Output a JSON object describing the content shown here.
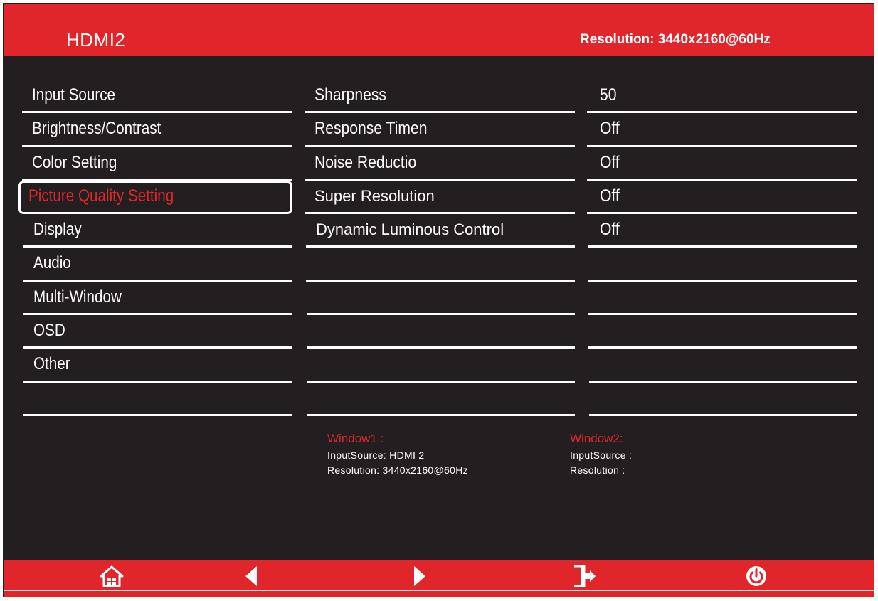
{
  "header": {
    "input_name": "HDMI2",
    "resolution": "Resolution: 3440x2160@60Hz"
  },
  "menu": [
    {
      "label": "Input Source",
      "selected": false
    },
    {
      "label": "Brightness/Contrast",
      "selected": false
    },
    {
      "label": "Color Setting",
      "selected": false
    },
    {
      "label": "Picture Quality Setting",
      "selected": true
    },
    {
      "label": "Display",
      "selected": false
    },
    {
      "label": "Audio",
      "selected": false
    },
    {
      "label": "Multi-Window",
      "selected": false
    },
    {
      "label": "OSD",
      "selected": false
    },
    {
      "label": "Other",
      "selected": false
    }
  ],
  "settings": [
    {
      "label": "Sharpness",
      "value": "50"
    },
    {
      "label": "Response Timen",
      "value": "Off"
    },
    {
      "label": "Noise Reductio",
      "value": "Off"
    },
    {
      "label": "Super Resolution",
      "value": "Off"
    },
    {
      "label": "Dynamic Luminous Control",
      "value": "Off"
    }
  ],
  "windows": {
    "window1": {
      "title": "Window1 :",
      "input_source": "InputSource: HDMI 2",
      "resolution": "Resolution: 3440x2160@60Hz"
    },
    "window2": {
      "title": "Window2:",
      "input_source": "InputSource :",
      "resolution": "Resolution :"
    }
  },
  "footer": {
    "buttons": [
      {
        "name": "home",
        "icon": "home-icon"
      },
      {
        "name": "left",
        "icon": "arrow-left-icon"
      },
      {
        "name": "right",
        "icon": "arrow-right-icon"
      },
      {
        "name": "exit",
        "icon": "exit-icon"
      },
      {
        "name": "power",
        "icon": "power-icon"
      }
    ]
  },
  "colors": {
    "accent": "#e0262a",
    "background": "#231f20",
    "text": "#ffffff"
  }
}
